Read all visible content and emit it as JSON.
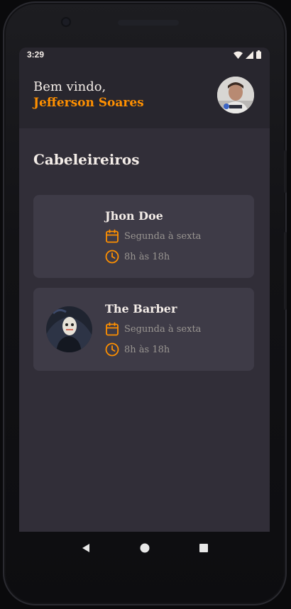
{
  "status_bar": {
    "time": "3:29",
    "icons": [
      "wifi-icon",
      "cellular-signal-icon",
      "battery-icon"
    ]
  },
  "header": {
    "greeting": "Bem vindo,",
    "user_name": "Jefferson Soares"
  },
  "section": {
    "title": "Cabeleireiros"
  },
  "providers": [
    {
      "name": "Jhon Doe",
      "days": "Segunda à sexta",
      "hours": "8h às 18h",
      "has_photo": false
    },
    {
      "name": "The Barber",
      "days": "Segunda à sexta",
      "hours": "8h às 18h",
      "has_photo": true
    }
  ],
  "nav": {
    "icons": [
      "back-icon",
      "home-icon",
      "recents-icon"
    ]
  },
  "colors": {
    "accent": "#ff9000",
    "background": "#312e38",
    "header": "#28262e",
    "card": "#3e3b47",
    "text": "#f4ede8",
    "muted": "#999591"
  }
}
